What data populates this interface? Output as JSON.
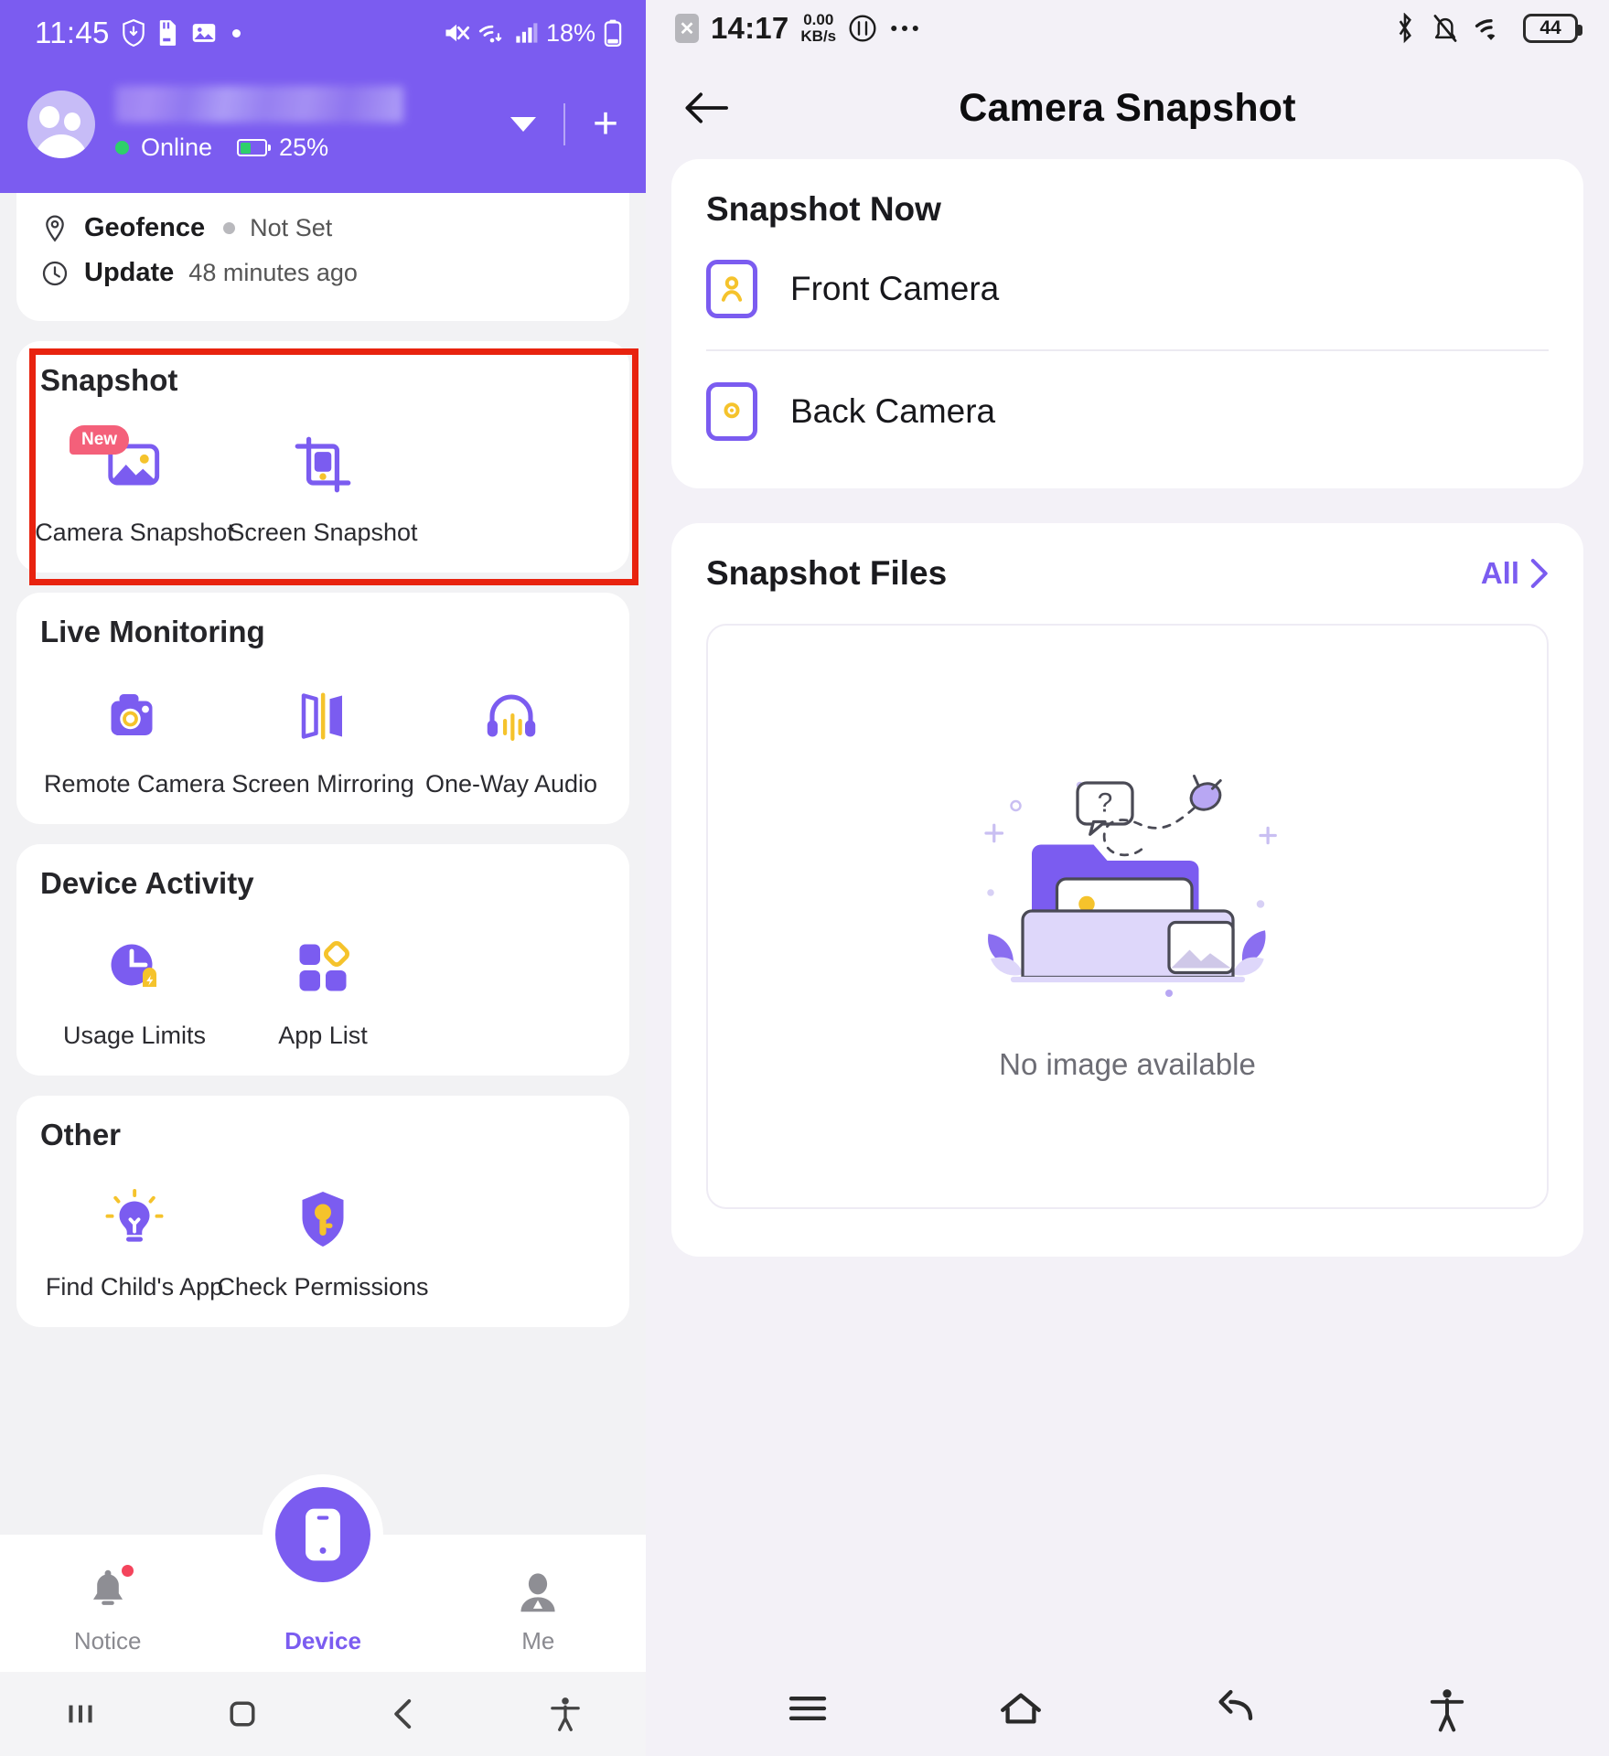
{
  "left": {
    "status_bar": {
      "time": "11:45",
      "battery_percent": "18%",
      "icons": [
        "shield-download-icon",
        "sd-card-icon",
        "image-icon",
        "dot-icon",
        "mute-icon",
        "wifi-icon",
        "signal-icon",
        "battery-icon"
      ]
    },
    "header": {
      "profile_name_masked": "",
      "status": "Online",
      "battery": "25%",
      "dropdown_icon": "chevron-down-icon",
      "add_icon": "plus-icon"
    },
    "info_card": {
      "geofence_label": "Geofence",
      "geofence_value": "Not Set",
      "update_label": "Update",
      "update_value": "48 minutes ago"
    },
    "sections": [
      {
        "title": "Snapshot",
        "highlighted": true,
        "items": [
          {
            "label": "Camera Snapshot",
            "icon": "photo-icon",
            "badge": "New"
          },
          {
            "label": "Screen Snapshot",
            "icon": "screen-crop-icon",
            "badge": ""
          }
        ]
      },
      {
        "title": "Live Monitoring",
        "highlighted": false,
        "items": [
          {
            "label": "Remote Camera",
            "icon": "camera-icon",
            "badge": ""
          },
          {
            "label": "Screen Mirroring",
            "icon": "screen-mirroring-icon",
            "badge": ""
          },
          {
            "label": "One-Way Audio",
            "icon": "headphones-icon",
            "badge": ""
          }
        ]
      },
      {
        "title": "Device Activity",
        "highlighted": false,
        "items": [
          {
            "label": "Usage Limits",
            "icon": "clock-limit-icon",
            "badge": ""
          },
          {
            "label": "App List",
            "icon": "app-grid-icon",
            "badge": ""
          }
        ]
      },
      {
        "title": "Other",
        "highlighted": false,
        "items": [
          {
            "label": "Find Child's App",
            "icon": "lightbulb-icon",
            "badge": ""
          },
          {
            "label": "Check Permissions",
            "icon": "shield-key-icon",
            "badge": ""
          }
        ]
      }
    ],
    "bottom_nav": [
      {
        "label": "Notice",
        "icon": "bell-icon",
        "active": false,
        "has_badge": true
      },
      {
        "label": "Device",
        "icon": "phone-icon",
        "active": true,
        "has_badge": false
      },
      {
        "label": "Me",
        "icon": "person-icon",
        "active": false,
        "has_badge": false
      }
    ],
    "gesture_bar": [
      "recents-icon",
      "home-icon",
      "back-icon",
      "accessibility-icon"
    ]
  },
  "right": {
    "status_bar": {
      "time": "14:17",
      "net_speed_value": "0.00",
      "net_speed_unit": "KB/s",
      "battery_percent": "44",
      "icons": [
        "sim-error-icon",
        "data-transfer-icon",
        "more-icon",
        "bluetooth-icon",
        "notification-off-icon",
        "wifi-icon",
        "battery-icon"
      ]
    },
    "app_bar": {
      "back_icon": "back-arrow-icon",
      "title": "Camera Snapshot"
    },
    "snapshot_now": {
      "title": "Snapshot Now",
      "items": [
        {
          "label": "Front Camera",
          "icon": "front-camera-icon"
        },
        {
          "label": "Back Camera",
          "icon": "back-camera-icon"
        }
      ]
    },
    "snapshot_files": {
      "title": "Snapshot Files",
      "all_label": "All",
      "all_icon": "chevron-right-icon",
      "empty_text": "No image available",
      "empty_illustration": "empty-folder-illustration"
    },
    "gesture_bar": [
      "menu-icon",
      "home-icon",
      "back-icon",
      "accessibility-icon"
    ]
  },
  "colors": {
    "brand_purple": "#7B5CF0",
    "accent_yellow": "#F5C32C",
    "highlight_red": "#E8230F",
    "badge_pink": "#F4607A",
    "online_green": "#2ED06A"
  }
}
